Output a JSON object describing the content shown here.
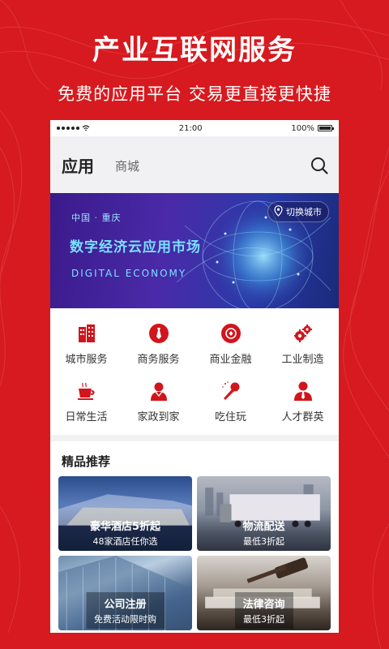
{
  "promo": {
    "headline": "产业互联网服务",
    "subline": "免费的应用平台  交易更直接更快捷"
  },
  "statusbar": {
    "time": "21:00",
    "battery": "100%"
  },
  "nav": {
    "tab_apps": "应用",
    "tab_mall": "商城"
  },
  "banner": {
    "location": "中国 · 重庆",
    "title": "数字经济云应用市场",
    "subtitle_en": "DIGITAL ECONOMY",
    "city_switch": "切换城市"
  },
  "categories": [
    {
      "label": "城市服务",
      "icon": "building-icon"
    },
    {
      "label": "商务服务",
      "icon": "tie-icon"
    },
    {
      "label": "商业金融",
      "icon": "coin-icon"
    },
    {
      "label": "工业制造",
      "icon": "gears-icon"
    },
    {
      "label": "日常生活",
      "icon": "coffee-cup-icon"
    },
    {
      "label": "家政到家",
      "icon": "housekeeper-icon"
    },
    {
      "label": "吃住玩",
      "icon": "microphone-icon"
    },
    {
      "label": "人才群英",
      "icon": "person-tie-icon"
    }
  ],
  "featured": {
    "title": "精品推荐",
    "cards": [
      {
        "title": "豪华酒店5折起",
        "subtitle": "48家酒店任你选"
      },
      {
        "title": "物流配送",
        "subtitle": "最低3折起"
      },
      {
        "title": "公司注册",
        "subtitle": "免费活动限时购"
      },
      {
        "title": "法律咨询",
        "subtitle": "最低3折起"
      }
    ]
  },
  "colors": {
    "brand_red": "#d61a1f",
    "icon_red": "#d0161c"
  }
}
